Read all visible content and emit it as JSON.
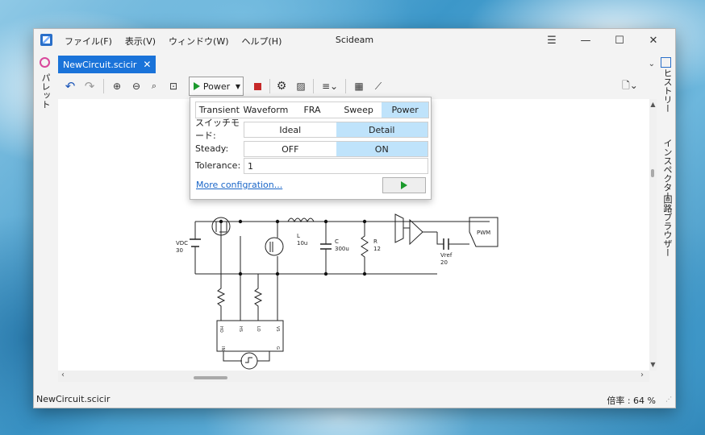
{
  "app": {
    "title": "Scideam"
  },
  "menu": [
    "ファイル(F)",
    "表示(V)",
    "ウィンドウ(W)",
    "ヘルプ(H)"
  ],
  "side_left": {
    "palette_label": "パレット"
  },
  "side_right": {
    "history_label": "ヒストリー",
    "inspector_label": "インスペクター",
    "browser_label": "回路ブラウザー"
  },
  "tab": {
    "name": "NewCircuit.scicir"
  },
  "toolbar": {
    "power_label": "Power"
  },
  "popup": {
    "tabs": [
      "Transient",
      "Waveform",
      "FRA",
      "Sweep",
      "Power"
    ],
    "selected_tab": "Power",
    "switch_mode_label": "スイッチモード:",
    "switch_mode_options": [
      "Ideal",
      "Detail"
    ],
    "switch_mode_selected": "Detail",
    "steady_label": "Steady:",
    "steady_options": [
      "OFF",
      "ON"
    ],
    "steady_selected": "ON",
    "tolerance_label": "Tolerance:",
    "tolerance_value": "1",
    "more_link": "More configration..."
  },
  "circuit": {
    "vdc_name": "VDC",
    "vdc_value": "30",
    "l_name": "L",
    "l_value": "10u",
    "c_name": "C",
    "c_value": "300u",
    "r_name": "R",
    "r_value": "12",
    "vref_name": "Vref",
    "vref_value": "20",
    "pwm_label": "PWM",
    "pin_ho": "HO",
    "pin_hs": "HS",
    "pin_lo": "LO",
    "pin_vs": "VS",
    "pin_in": "IN",
    "pin_g": "G"
  },
  "status": {
    "file": "NewCircuit.scicir",
    "zoom": "倍率 : 64 %"
  },
  "colors": {
    "accent": "#1a73d9",
    "selection": "#bfe3fb",
    "run": "#1b9a2c",
    "stop": "#c62828"
  }
}
